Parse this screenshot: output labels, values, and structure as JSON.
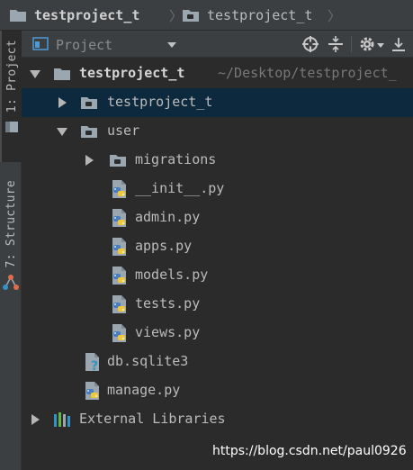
{
  "breadcrumb": {
    "project": "testproject_t",
    "folder": "testproject_t"
  },
  "sidebar": {
    "project_tab": "1: Project",
    "structure_tab": "7: Structure"
  },
  "panel": {
    "view_selector": "Project"
  },
  "tree": {
    "root": {
      "label": "testproject_t",
      "path": "~/Desktop/testproject_"
    },
    "items": [
      {
        "label": "testproject_t"
      },
      {
        "label": "user"
      },
      {
        "label": "migrations"
      },
      {
        "label": "__init__.py"
      },
      {
        "label": "admin.py"
      },
      {
        "label": "apps.py"
      },
      {
        "label": "models.py"
      },
      {
        "label": "tests.py"
      },
      {
        "label": "views.py"
      },
      {
        "label": "db.sqlite3"
      },
      {
        "label": "manage.py"
      }
    ],
    "external": "External Libraries"
  },
  "watermark": "https://blog.csdn.net/paul0926",
  "colors": {
    "background": "#2b2b2b",
    "toolbar": "#3c3f41",
    "selection": "#0d293e",
    "python_blue": "#4a7fbf",
    "python_yellow": "#f0c93a"
  }
}
